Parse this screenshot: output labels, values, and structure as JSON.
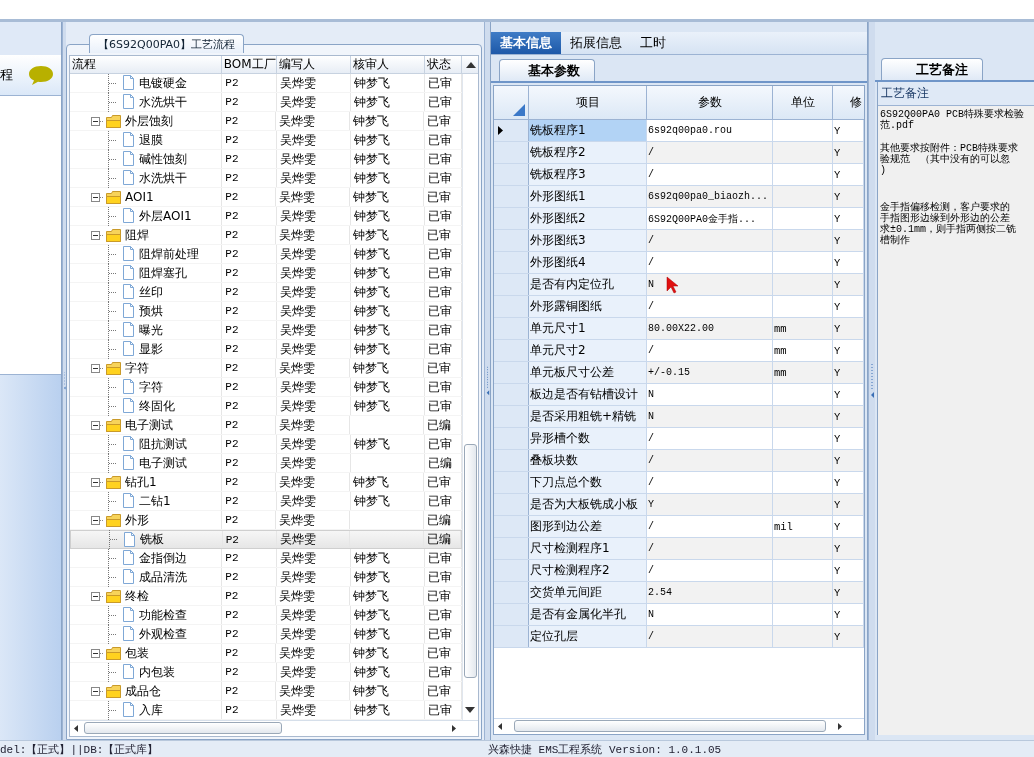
{
  "sidebar": {
    "title": "程"
  },
  "process_panel": {
    "title": "【6S92Q00PA0】工艺流程",
    "columns": [
      "流程",
      "BOM工厂",
      "编写人",
      "核审人",
      "状态"
    ],
    "rows": [
      {
        "children": [
          {
            "kind": "file",
            "label": "电镀硬金",
            "bom": "P2",
            "writer": "吴烨雯",
            "reviewer": "钟梦飞",
            "status": "已审",
            "selected": false
          },
          {
            "kind": "file",
            "label": "水洗烘干",
            "bom": "P2",
            "writer": "吴烨雯",
            "reviewer": "钟梦飞",
            "status": "已审",
            "selected": false
          }
        ]
      },
      {
        "kind": "folder",
        "label": "外层蚀刻",
        "bom": "P2",
        "writer": "吴烨雯",
        "reviewer": "钟梦飞",
        "status": "已审",
        "expanded": true,
        "selected": false,
        "children": [
          {
            "kind": "file",
            "label": "退膜",
            "bom": "P2",
            "writer": "吴烨雯",
            "reviewer": "钟梦飞",
            "status": "已审",
            "selected": false
          },
          {
            "kind": "file",
            "label": "碱性蚀刻",
            "bom": "P2",
            "writer": "吴烨雯",
            "reviewer": "钟梦飞",
            "status": "已审",
            "selected": false
          },
          {
            "kind": "file",
            "label": "水洗烘干",
            "bom": "P2",
            "writer": "吴烨雯",
            "reviewer": "钟梦飞",
            "status": "已审",
            "selected": false
          }
        ]
      },
      {
        "kind": "folder",
        "label": "AOI1",
        "bom": "P2",
        "writer": "吴烨雯",
        "reviewer": "钟梦飞",
        "status": "已审",
        "expanded": true,
        "selected": false,
        "children": [
          {
            "kind": "file",
            "label": "外层AOI1",
            "bom": "P2",
            "writer": "吴烨雯",
            "reviewer": "钟梦飞",
            "status": "已审",
            "selected": false
          }
        ]
      },
      {
        "kind": "folder",
        "label": "阻焊",
        "bom": "P2",
        "writer": "吴烨雯",
        "reviewer": "钟梦飞",
        "status": "已审",
        "expanded": true,
        "selected": false,
        "children": [
          {
            "kind": "file",
            "label": "阻焊前处理",
            "bom": "P2",
            "writer": "吴烨雯",
            "reviewer": "钟梦飞",
            "status": "已审",
            "selected": false
          },
          {
            "kind": "file",
            "label": "阻焊塞孔",
            "bom": "P2",
            "writer": "吴烨雯",
            "reviewer": "钟梦飞",
            "status": "已审",
            "selected": false
          },
          {
            "kind": "file",
            "label": "丝印",
            "bom": "P2",
            "writer": "吴烨雯",
            "reviewer": "钟梦飞",
            "status": "已审",
            "selected": false
          },
          {
            "kind": "file",
            "label": "预烘",
            "bom": "P2",
            "writer": "吴烨雯",
            "reviewer": "钟梦飞",
            "status": "已审",
            "selected": false
          },
          {
            "kind": "file",
            "label": "曝光",
            "bom": "P2",
            "writer": "吴烨雯",
            "reviewer": "钟梦飞",
            "status": "已审",
            "selected": false
          },
          {
            "kind": "file",
            "label": "显影",
            "bom": "P2",
            "writer": "吴烨雯",
            "reviewer": "钟梦飞",
            "status": "已审",
            "selected": false
          }
        ]
      },
      {
        "kind": "folder",
        "label": "字符",
        "bom": "P2",
        "writer": "吴烨雯",
        "reviewer": "钟梦飞",
        "status": "已审",
        "expanded": true,
        "selected": false,
        "children": [
          {
            "kind": "file",
            "label": "字符",
            "bom": "P2",
            "writer": "吴烨雯",
            "reviewer": "钟梦飞",
            "status": "已审",
            "selected": false
          },
          {
            "kind": "file",
            "label": "终固化",
            "bom": "P2",
            "writer": "吴烨雯",
            "reviewer": "钟梦飞",
            "status": "已审",
            "selected": false
          }
        ]
      },
      {
        "kind": "folder",
        "label": "电子测试",
        "bom": "P2",
        "writer": "吴烨雯",
        "status": "已编",
        "expanded": true,
        "selected": false,
        "children": [
          {
            "kind": "file",
            "label": "阻抗测试",
            "bom": "P2",
            "writer": "吴烨雯",
            "reviewer": "钟梦飞",
            "status": "已审",
            "selected": false
          },
          {
            "kind": "file",
            "label": "电子测试",
            "bom": "P2",
            "writer": "吴烨雯",
            "status": "已编",
            "selected": false
          }
        ]
      },
      {
        "kind": "folder",
        "label": "钻孔1",
        "bom": "P2",
        "writer": "吴烨雯",
        "reviewer": "钟梦飞",
        "status": "已审",
        "expanded": true,
        "selected": false,
        "children": [
          {
            "kind": "file",
            "label": "二钻1",
            "bom": "P2",
            "writer": "吴烨雯",
            "reviewer": "钟梦飞",
            "status": "已审",
            "selected": false
          }
        ]
      },
      {
        "kind": "folder",
        "label": "外形",
        "bom": "P2",
        "writer": "吴烨雯",
        "status": "已编",
        "expanded": true,
        "selected": false,
        "children": [
          {
            "kind": "file",
            "label": "铣板",
            "bom": "P2",
            "writer": "吴烨雯",
            "status": "已编",
            "selected": true
          },
          {
            "kind": "file",
            "label": "金指倒边",
            "bom": "P2",
            "writer": "吴烨雯",
            "reviewer": "钟梦飞",
            "status": "已审",
            "selected": false
          },
          {
            "kind": "file",
            "label": "成品清洗",
            "bom": "P2",
            "writer": "吴烨雯",
            "reviewer": "钟梦飞",
            "status": "已审",
            "selected": false
          }
        ]
      },
      {
        "kind": "folder",
        "label": "终检",
        "bom": "P2",
        "writer": "吴烨雯",
        "reviewer": "钟梦飞",
        "status": "已审",
        "expanded": true,
        "selected": false,
        "children": [
          {
            "kind": "file",
            "label": "功能检查",
            "bom": "P2",
            "writer": "吴烨雯",
            "reviewer": "钟梦飞",
            "status": "已审",
            "selected": false
          },
          {
            "kind": "file",
            "label": "外观检查",
            "bom": "P2",
            "writer": "吴烨雯",
            "reviewer": "钟梦飞",
            "status": "已审",
            "selected": false
          }
        ]
      },
      {
        "kind": "folder",
        "label": "包装",
        "bom": "P2",
        "writer": "吴烨雯",
        "reviewer": "钟梦飞",
        "status": "已审",
        "expanded": true,
        "selected": false,
        "children": [
          {
            "kind": "file",
            "label": "内包装",
            "bom": "P2",
            "writer": "吴烨雯",
            "reviewer": "钟梦飞",
            "status": "已审",
            "selected": false
          }
        ]
      },
      {
        "kind": "folder",
        "label": "成品仓",
        "bom": "P2",
        "writer": "吴烨雯",
        "reviewer": "钟梦飞",
        "status": "已审",
        "expanded": true,
        "selected": false,
        "children": [
          {
            "kind": "file",
            "label": "入库",
            "bom": "P2",
            "writer": "吴烨雯",
            "reviewer": "钟梦飞",
            "status": "已审",
            "selected": false
          }
        ]
      }
    ]
  },
  "detail_tabs": [
    {
      "label": "基本信息",
      "selected": true
    },
    {
      "label": "拓展信息",
      "selected": false
    },
    {
      "label": "工时",
      "selected": false
    }
  ],
  "param_tabs": [
    {
      "label": "基本参数",
      "selected": true
    }
  ],
  "param_grid": {
    "columns": [
      "项目",
      "参数",
      "单位",
      "修"
    ],
    "rows": [
      {
        "item": "铣板程序1",
        "value": "6s92q00pa0.rou",
        "modified": "Y",
        "selected": true
      },
      {
        "item": "铣板程序2",
        "value": "/",
        "modified": "Y",
        "selected": false
      },
      {
        "item": "铣板程序3",
        "value": "/",
        "modified": "Y",
        "selected": false
      },
      {
        "item": "外形图纸1",
        "value": "6s92q00pa0_biaozh...",
        "modified": "Y",
        "selected": false
      },
      {
        "item": "外形图纸2",
        "value": "6S92Q00PA0金手指...",
        "modified": "Y",
        "selected": false
      },
      {
        "item": "外形图纸3",
        "value": "/",
        "modified": "Y",
        "selected": false
      },
      {
        "item": "外形图纸4",
        "value": "/",
        "modified": "Y",
        "selected": false
      },
      {
        "item": "是否有内定位孔",
        "value": "N",
        "modified": "Y",
        "selected": false
      },
      {
        "item": "外形露铜图纸",
        "value": "/",
        "modified": "Y",
        "selected": false
      },
      {
        "item": "单元尺寸1",
        "value": "80.00X22.00",
        "unit": "mm",
        "modified": "Y",
        "selected": false
      },
      {
        "item": "单元尺寸2",
        "value": "/",
        "unit": "mm",
        "modified": "Y",
        "selected": false
      },
      {
        "item": "单元板尺寸公差",
        "value": "+/-0.15",
        "unit": "mm",
        "modified": "Y",
        "selected": false
      },
      {
        "item": "板边是否有钻槽设计",
        "value": "N",
        "modified": "Y",
        "selected": false
      },
      {
        "item": "是否采用粗铣+精铣",
        "value": "N",
        "modified": "Y",
        "selected": false
      },
      {
        "item": "异形槽个数",
        "value": "/",
        "modified": "Y",
        "selected": false
      },
      {
        "item": "叠板块数",
        "value": "/",
        "modified": "Y",
        "selected": false
      },
      {
        "item": "下刀点总个数",
        "value": "/",
        "modified": "Y",
        "selected": false
      },
      {
        "item": "是否为大板铣成小板",
        "value": "Y",
        "modified": "Y",
        "selected": false
      },
      {
        "item": "图形到边公差",
        "value": "/",
        "unit": "mil",
        "modified": "Y",
        "selected": false
      },
      {
        "item": "尺寸检测程序1",
        "value": "/",
        "modified": "Y",
        "selected": false
      },
      {
        "item": "尺寸检测程序2",
        "value": "/",
        "modified": "Y",
        "selected": false
      },
      {
        "item": "交货单元间距",
        "value": "2.54",
        "modified": "Y",
        "selected": false
      },
      {
        "item": "是否有金属化半孔",
        "value": "N",
        "modified": "Y",
        "selected": false
      },
      {
        "item": "定位孔层",
        "value": "/",
        "modified": "Y",
        "selected": false
      }
    ]
  },
  "notes": {
    "tab": "工艺备注",
    "label": "工艺备注",
    "paragraphs": [
      [
        "6S92Q00PA0 PCB特殊要求检验",
        "范.pdf"
      ],
      [
        "其他要求按附件：PCB特殊要求",
        "验规范　（其中没有的可以忽",
        ")"
      ],
      [
        "金手指偏移检测，客户要求的",
        "手指图形边缘到外形边的公差",
        "求±0.1mm，则手指两侧按二铣",
        "槽制作"
      ]
    ]
  },
  "status_bar": {
    "left": "del:【正式】||DB:【正式库】",
    "center": "兴森快捷 EMS工程系统 Version: 1.0.1.05"
  }
}
